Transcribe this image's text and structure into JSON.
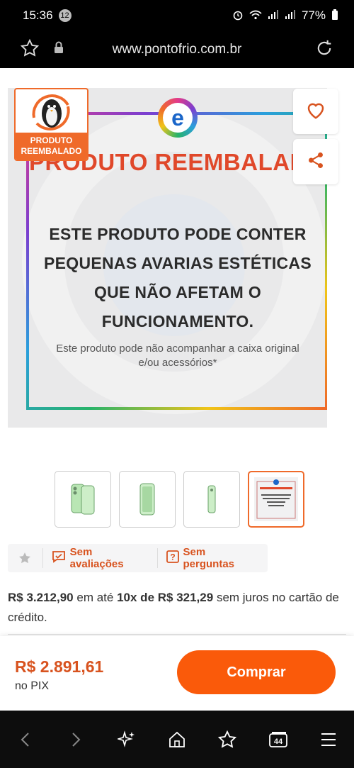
{
  "status_bar": {
    "time": "15:36",
    "notification_count": "12",
    "network1": "VoLTE1",
    "network2": "VoLTE2",
    "battery": "77%"
  },
  "browser": {
    "url": "www.pontofrio.com.br",
    "tabs_count": "44"
  },
  "product_image": {
    "badge_label": "PRODUTO REEMBALADO",
    "title": "PRODUTO REEMBALADO",
    "body": "ESTE PRODUTO PODE CONTER PEQUENAS AVARIAS ESTÉTICAS QUE NÃO AFETAM O FUNCIONAMENTO.",
    "footnote": "Este produto pode não acompanhar a caixa original e/ou acessórios*",
    "logo_letter": "e"
  },
  "thumbnails": [
    {
      "kind": "phone-front-back",
      "active": false
    },
    {
      "kind": "phone-front",
      "active": false
    },
    {
      "kind": "phone-side",
      "active": false
    },
    {
      "kind": "reembalado-notice",
      "active": true
    }
  ],
  "reviews": {
    "reviews_label": "Sem avaliações",
    "questions_label": "Sem perguntas"
  },
  "pricing": {
    "card_price": "R$ 3.212,90",
    "text_em_ate": "em até",
    "installments": "10x de R$ 321,29",
    "text_rest": "sem juros no cartão de crédito.",
    "pix_price": "R$ 2.891,61",
    "pix_label": "no PIX"
  },
  "buy": {
    "button_label": "Comprar"
  },
  "colors": {
    "accent": "#fa5a0a",
    "price_orange": "#d8531f"
  }
}
